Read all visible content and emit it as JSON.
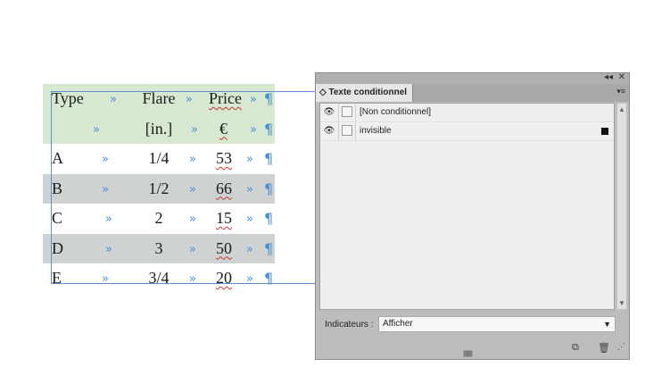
{
  "table": {
    "header": [
      {
        "type": "Type",
        "flare": "Flare",
        "price": "Price"
      },
      {
        "type": "",
        "flare": "[in.]",
        "price": "€"
      }
    ],
    "rows": [
      {
        "type": "A",
        "flare": "1/4",
        "price": "53"
      },
      {
        "type": "B",
        "flare": "1/2",
        "price": "66"
      },
      {
        "type": "C",
        "flare": "2",
        "price": "15"
      },
      {
        "type": "D",
        "flare": "3",
        "price": "50"
      },
      {
        "type": "E",
        "flare": "3/4",
        "price": "20"
      }
    ],
    "tab_glyph": "»",
    "para_glyph": "¶"
  },
  "panel": {
    "title": "Texte conditionnel",
    "collapse_glyph": "◂◂",
    "close_glyph": "✕",
    "menu_glyph": "▾≡",
    "items": [
      {
        "label": "[Non conditionnel]",
        "visible": true
      },
      {
        "label": "invisible",
        "visible": true
      }
    ],
    "indicators_label": "Indicateurs :",
    "indicators_value": "Afficher",
    "icons": {
      "new": "new-icon",
      "delete": "trash-icon"
    }
  }
}
